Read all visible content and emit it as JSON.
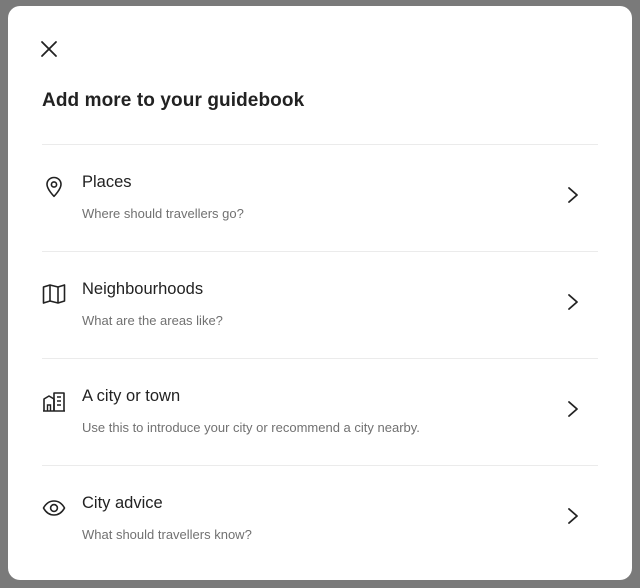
{
  "modal": {
    "close_icon": "close-icon",
    "title": "Add more to your guidebook"
  },
  "items": [
    {
      "icon": "map-pin-icon",
      "title": "Places",
      "subtitle": "Where should travellers go?"
    },
    {
      "icon": "map-icon",
      "title": "Neighbourhoods",
      "subtitle": "What are the areas like?"
    },
    {
      "icon": "buildings-icon",
      "title": "A city or town",
      "subtitle": "Use this to introduce your city or recommend a city nearby."
    },
    {
      "icon": "eye-icon",
      "title": "City advice",
      "subtitle": "What should travellers know?"
    }
  ],
  "colors": {
    "text_primary": "#222222",
    "text_secondary": "#717171",
    "divider": "#ebebeb"
  }
}
